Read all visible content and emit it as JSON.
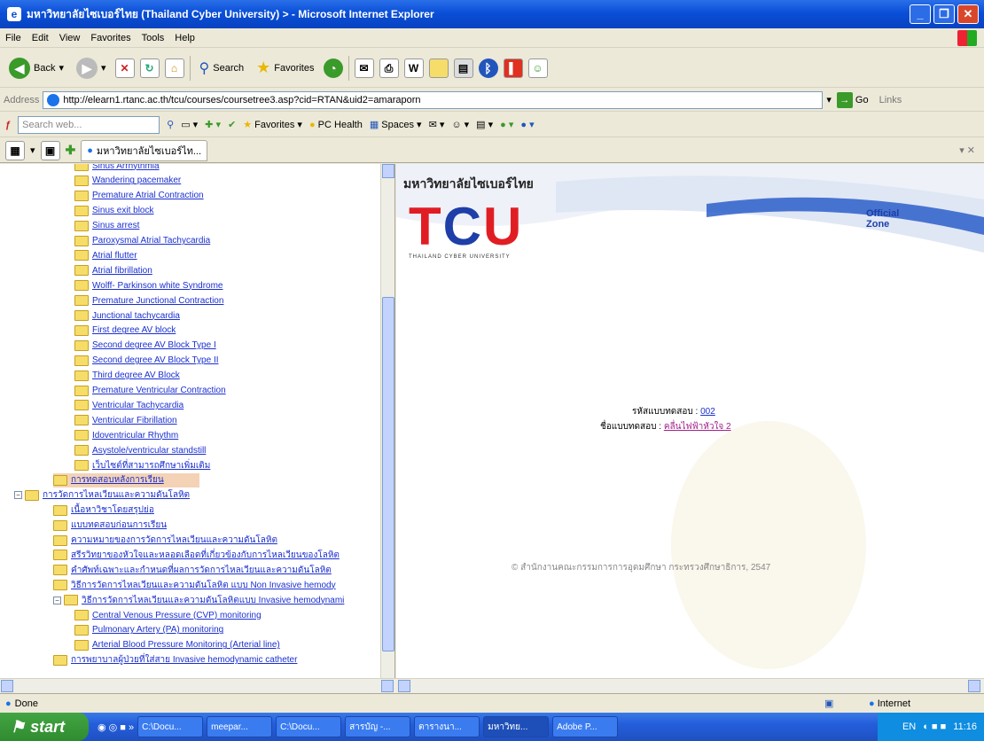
{
  "window": {
    "title": "มหาวิทยาลัยไซเบอร์ไทย (Thailand Cyber University) > - Microsoft Internet Explorer"
  },
  "menu": [
    "File",
    "Edit",
    "View",
    "Favorites",
    "Tools",
    "Help"
  ],
  "toolbar": {
    "back": "Back",
    "search": "Search",
    "favorites": "Favorites"
  },
  "address": {
    "label": "Address",
    "url": "http://elearn1.rtanc.ac.th/tcu/courses/coursetree3.asp?cid=RTAN&uid2=amaraporn",
    "go": "Go",
    "links": "Links"
  },
  "google_bar": {
    "search_placeholder": "Search web...",
    "favorites": "Favorites",
    "pchealth": "PC Health",
    "spaces": "Spaces"
  },
  "tab": {
    "label": "มหาวิทยาลัยไซเบอร์ไท..."
  },
  "tree": {
    "items": [
      {
        "label": "Sinus Arrhythmia",
        "level": 2
      },
      {
        "label": "Wandering pacemaker",
        "level": 2
      },
      {
        "label": "Premature Atrial Contraction",
        "level": 2
      },
      {
        "label": "Sinus exit block",
        "level": 2
      },
      {
        "label": "Sinus arrest",
        "level": 2
      },
      {
        "label": "Paroxysmal Atrial Tachycardia",
        "level": 2
      },
      {
        "label": "Atrial flutter",
        "level": 2
      },
      {
        "label": "Atrial fibrillation",
        "level": 2
      },
      {
        "label": "Wolff- Parkinson white Syndrome",
        "level": 2
      },
      {
        "label": "Premature Junctional Contraction",
        "level": 2
      },
      {
        "label": "Junctional tachycardia",
        "level": 2
      },
      {
        "label": "First degree AV block",
        "level": 2
      },
      {
        "label": "Second degree AV Block Type I",
        "level": 2
      },
      {
        "label": "Second degree AV Block Type II",
        "level": 2
      },
      {
        "label": "Third degree AV Block",
        "level": 2
      },
      {
        "label": "Premature Ventricular Contraction",
        "level": 2
      },
      {
        "label": "Ventricular Tachycardia",
        "level": 2
      },
      {
        "label": "Ventricular Fibrillation",
        "level": 2
      },
      {
        "label": "Idoventricular Rhythm",
        "level": 2
      },
      {
        "label": "Asystole/ventricular standstill",
        "level": 2
      },
      {
        "label": "เว็บไซต์ที่สามารถศึกษาเพิ่มเติม",
        "level": 2
      },
      {
        "label": "การทดสอบหลังการเรียน",
        "level": 1,
        "selected": true
      },
      {
        "label": "การวัดการไหลเวียนและความดันโลหิต",
        "level": 0,
        "expander": "−"
      },
      {
        "label": "เนื้อหาวิชาโดยสรุปย่อ",
        "level": 1
      },
      {
        "label": "แบบทดสอบก่อนการเรียน",
        "level": 1
      },
      {
        "label": "ความหมายของการวัดการไหลเวียนและความดันโลหิต",
        "level": 1
      },
      {
        "label": "สรีรวิทยาของหัวใจและหลอดเลือดที่เกี่ยวข้องกับการไหลเวียนของโลหิต",
        "level": 1
      },
      {
        "label": "คำศัพท์เฉพาะและกำหนดที่ผลการวัดการไหลเวียนและความดันโลหิต",
        "level": 1
      },
      {
        "label": "วิธีการวัดการไหลเวียนและความดันโลหิต แบบ Non Invasive hemody",
        "level": 1
      },
      {
        "label": "วิธีการวัดการไหลเวียนและความดันโลหิตแบบ Invasive hemodynami",
        "level": 1,
        "expander": "−"
      },
      {
        "label": "Central Venous Pressure (CVP) monitoring",
        "level": 2
      },
      {
        "label": "Pulmonary Artery (PA) monitoring",
        "level": 2
      },
      {
        "label": "Arterial Blood Pressure Monitoring (Arterial line)",
        "level": 2
      },
      {
        "label": "การพยาบาลผู้ป่วยที่ใส่สาย Invasive hemodynamic catheter",
        "level": 1
      }
    ]
  },
  "right": {
    "header": "มหาวิทยาลัยไซเบอร์ไทย",
    "logo_text": "TCU",
    "logo_sub": "THAILAND CYBER UNIVERSITY",
    "official": "Official",
    "zone": "Zone",
    "test_code_label": "รหัสแบบทดสอบ :",
    "test_code": "002",
    "test_name_label": "ชื่อแบบทดสอบ :",
    "test_name": "คลื่นไฟฟ้าหัวใจ 2",
    "copyright": "© สำนักงานคณะกรรมการการอุดมศึกษา กระทรวงศึกษาธิการ, 2547"
  },
  "status": {
    "text": "Done",
    "zone": "Internet"
  },
  "taskbar": {
    "start": "start",
    "tasks": [
      "C:\\Docu...",
      "meepar...",
      "C:\\Docu...",
      "สารบัญ -...",
      "ตารางนา...",
      "มหาวิทย...",
      "Adobe P..."
    ],
    "lang": "EN",
    "clock": "11:16"
  }
}
